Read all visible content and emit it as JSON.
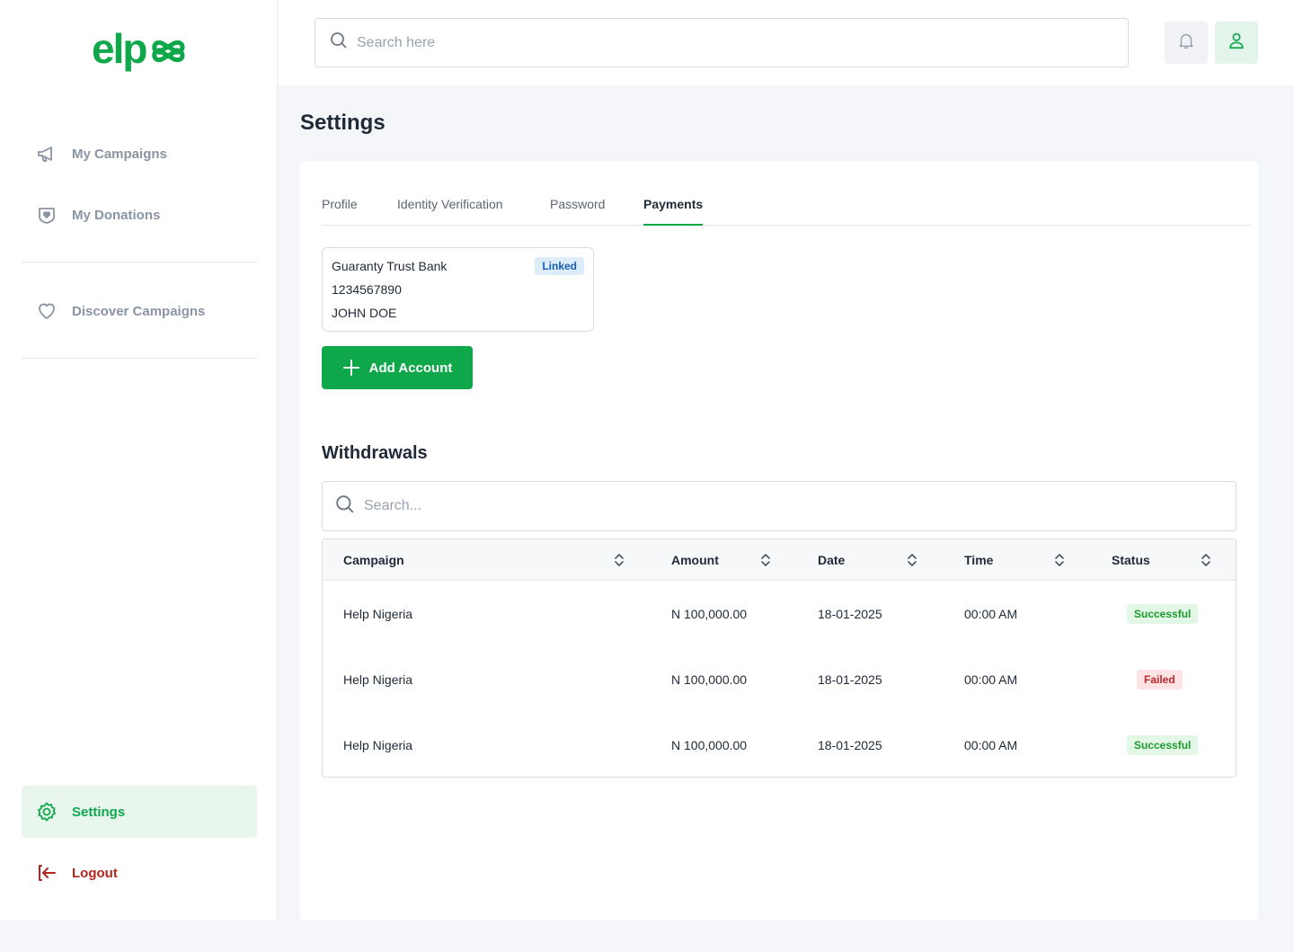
{
  "brand": {
    "logo_text": "elpx",
    "accent": "#0ea84b"
  },
  "sidebar": {
    "items": [
      {
        "label": "My Campaigns",
        "icon": "megaphone-icon"
      },
      {
        "label": "My Donations",
        "icon": "donation-heart-icon"
      },
      {
        "label": "Discover Campaigns",
        "icon": "heart-icon"
      }
    ],
    "settings_label": "Settings",
    "logout_label": "Logout"
  },
  "topbar": {
    "search_placeholder": "Search here"
  },
  "page": {
    "title": "Settings"
  },
  "tabs": [
    {
      "label": "Profile",
      "active": false
    },
    {
      "label": "Identity Verification",
      "active": false
    },
    {
      "label": "Password",
      "active": false
    },
    {
      "label": "Payments",
      "active": true
    }
  ],
  "account": {
    "bank": "Guaranty Trust Bank",
    "number": "1234567890",
    "name": "JOHN DOE",
    "badge": "Linked"
  },
  "add_account_label": "Add Account",
  "withdrawals": {
    "title": "Withdrawals",
    "search_placeholder": "Search...",
    "columns": [
      "Campaign",
      "Amount",
      "Date",
      "Time",
      "Status"
    ],
    "rows": [
      {
        "campaign": "Help Nigeria",
        "amount": "N 100,000.00",
        "date": "18-01-2025",
        "time": "00:00 AM",
        "status": "Successful"
      },
      {
        "campaign": "Help Nigeria",
        "amount": "N 100,000.00",
        "date": "18-01-2025",
        "time": "00:00 AM",
        "status": "Failed"
      },
      {
        "campaign": "Help Nigeria",
        "amount": "N 100,000.00",
        "date": "18-01-2025",
        "time": "00:00 AM",
        "status": "Successful"
      }
    ]
  }
}
